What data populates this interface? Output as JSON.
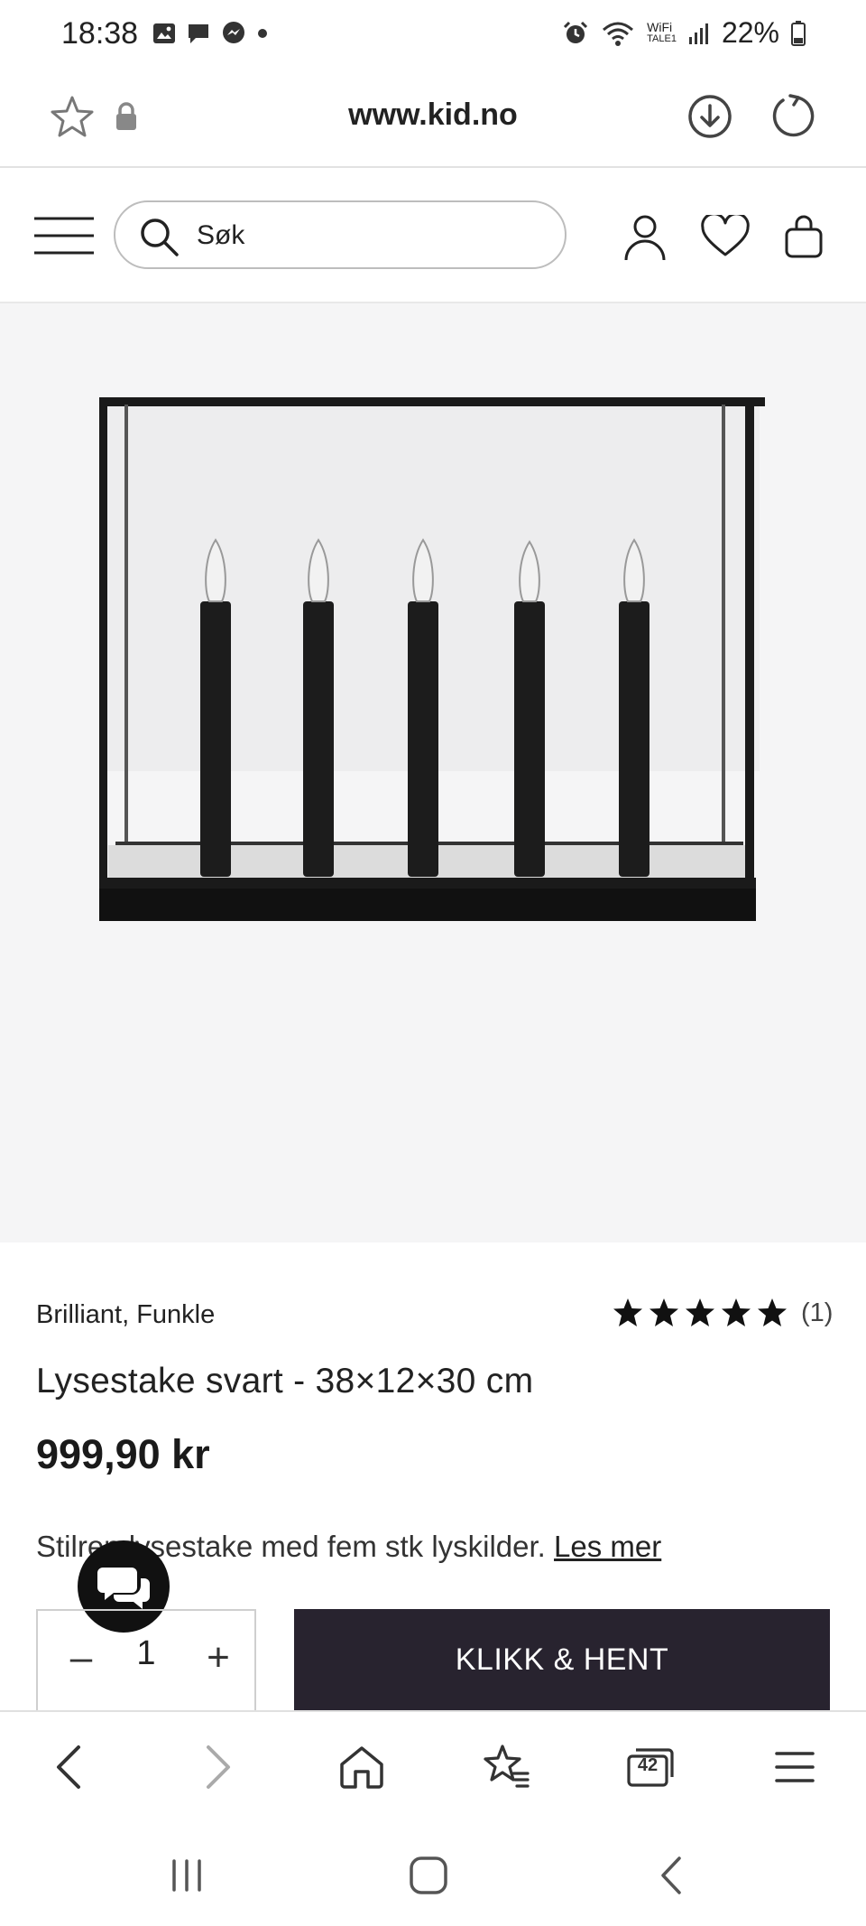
{
  "status_bar": {
    "time": "18:38",
    "wifi_label": "WiFi",
    "carrier": "TALE1",
    "battery": "22%"
  },
  "browser": {
    "url": "www.kid.no"
  },
  "site_header": {
    "search_placeholder": "Søk"
  },
  "product": {
    "brand": "Brilliant, Funkle",
    "rating_stars": 5,
    "rating_count": "(1)",
    "title": "Lysestake svart - 38×12×30 cm",
    "price": "999,90 kr",
    "description": "Stilren lysestake med fem stk lyskilder.",
    "read_more": "Les mer"
  },
  "purchase": {
    "quantity": "1",
    "minus_symbol": "–",
    "plus_symbol": "+",
    "cta_label": "KLIKK & HENT"
  },
  "browser_nav": {
    "tabs_count": "42"
  },
  "colors": {
    "cta_bg": "#28232f",
    "image_bg": "#f5f5f6"
  }
}
